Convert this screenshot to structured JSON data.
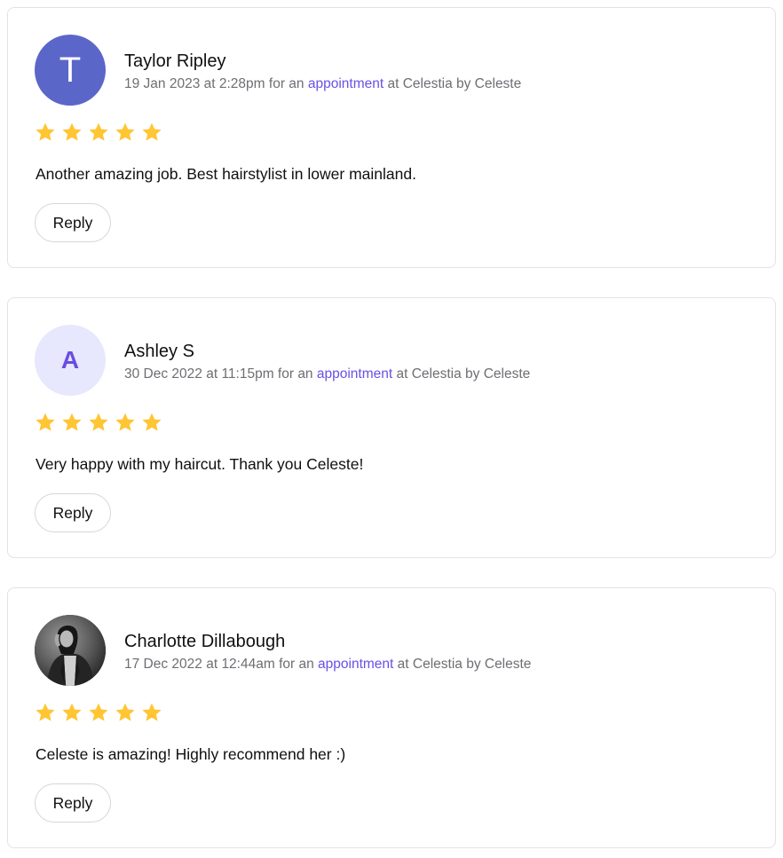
{
  "colors": {
    "star": "#FFC533",
    "link": "#6950E6",
    "avatar_solid": "#5B66C9",
    "avatar_light_bg": "#E7E7FD",
    "avatar_light_text": "#6A4CE0"
  },
  "reviews": [
    {
      "avatar_initial": "T",
      "name": "Taylor Ripley",
      "datetime": "19 Jan 2023 at 2:28pm",
      "for_text": "for an",
      "link_text": "appointment",
      "venue_text": "at Celestia by Celeste",
      "rating": 5,
      "comment": "Another amazing job. Best hairstylist in lower mainland.",
      "reply_label": "Reply"
    },
    {
      "avatar_initial": "A",
      "name": "Ashley S",
      "datetime": "30 Dec 2022 at 11:15pm",
      "for_text": "for an",
      "link_text": "appointment",
      "venue_text": "at Celestia by Celeste",
      "rating": 5,
      "comment": "Very happy with my haircut. Thank you Celeste!",
      "reply_label": "Reply"
    },
    {
      "avatar_initial": "",
      "name": "Charlotte Dillabough",
      "datetime": "17 Dec 2022 at 12:44am",
      "for_text": "for an",
      "link_text": "appointment",
      "venue_text": "at Celestia by Celeste",
      "rating": 5,
      "comment": "Celeste is amazing! Highly recommend her :)",
      "reply_label": "Reply"
    }
  ]
}
